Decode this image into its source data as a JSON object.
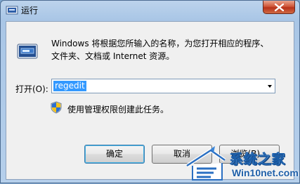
{
  "window": {
    "title": "运行",
    "close_icon": "close-icon"
  },
  "dialog": {
    "description_line1": "Windows 将根据您所输入的名称，为您打开相应的程序、",
    "description_line2": "文件夹、文档或 Internet 资源。",
    "open_label": "打开(O):",
    "open_value": "regedit",
    "admin_note": "使用管理权限创建此任务。"
  },
  "buttons": {
    "ok": "确定",
    "cancel": "取消",
    "browse": "浏览(B)..."
  },
  "watermark": {
    "brand": "系统之家",
    "url": "Win10net.com"
  },
  "colors": {
    "selection": "#3399ff",
    "default_button_border": "#3c7fb1",
    "close_button": "#c9432a"
  }
}
